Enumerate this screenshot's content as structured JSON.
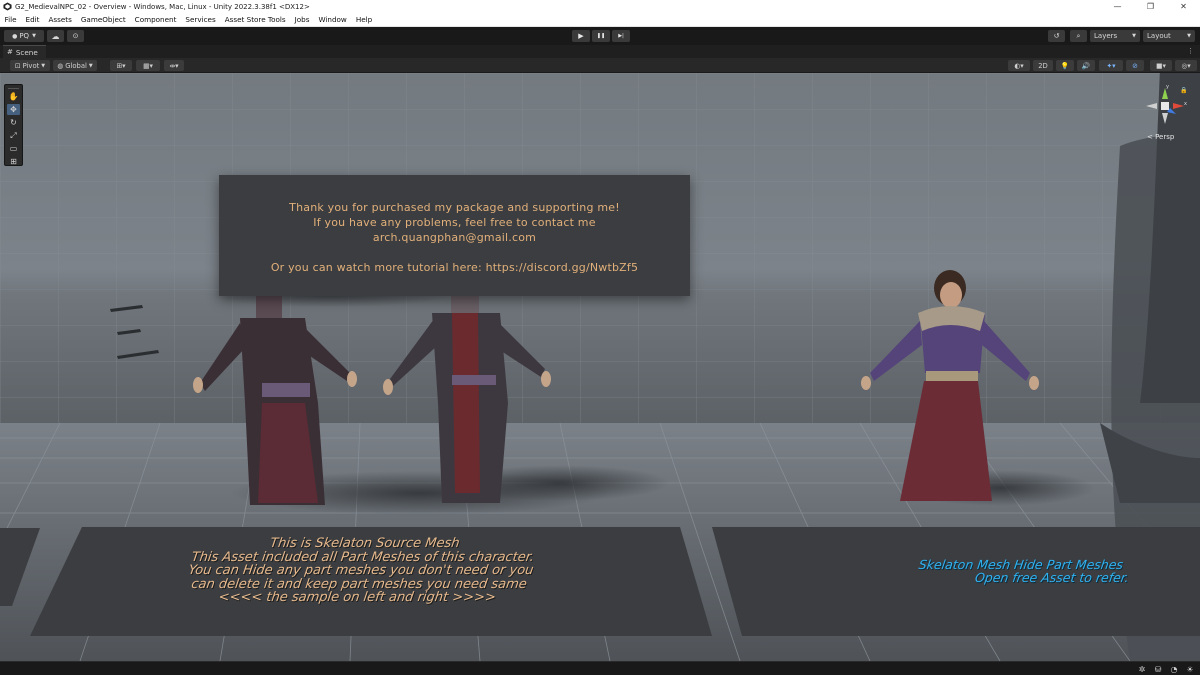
{
  "window": {
    "title": "G2_MedievalNPC_02 - Overview - Windows, Mac, Linux - Unity 2022.3.38f1 <DX12>",
    "minimize": "—",
    "maximize": "❐",
    "close": "✕"
  },
  "menu": [
    "File",
    "Edit",
    "Assets",
    "GameObject",
    "Component",
    "Services",
    "Asset Store Tools",
    "Jobs",
    "Window",
    "Help"
  ],
  "toolbar": {
    "account_label": "PQ",
    "play_icon": "▶",
    "pause_icon": "❚❚",
    "step_icon": "▶|",
    "layers_label": "Layers",
    "layout_label": "Layout"
  },
  "scene_tab": {
    "label": "Scene",
    "icon": "grid-icon"
  },
  "scene_toolbar": {
    "pivot_label": "Pivot",
    "global_label": "Global",
    "mode_2d_label": "2D"
  },
  "tools": [
    {
      "name": "hand-tool",
      "glyph": "✋"
    },
    {
      "name": "move-tool",
      "glyph": "✥"
    },
    {
      "name": "rotate-tool",
      "glyph": "↻"
    },
    {
      "name": "scale-tool",
      "glyph": "⤢"
    },
    {
      "name": "rect-tool",
      "glyph": "▭"
    },
    {
      "name": "transform-tool",
      "glyph": "⊞"
    }
  ],
  "gizmo": {
    "y_label": "y",
    "x_label": "x",
    "projection_label": "< Persp"
  },
  "billboard": {
    "line1": "Thank you for purchased my package and supporting me!",
    "line2": "If you have any problems, feel free to contact me",
    "line3": "arch.quangphan@gmail.com",
    "line4": "Or you can watch more tutorial here: https://discord.gg/NwtbZf5"
  },
  "floor_left": {
    "line1": "This is Skelaton Source Mesh",
    "line2": "This Asset included all Part Meshes of this character.",
    "line3": "You can Hide any part meshes you don't need or you",
    "line4": "can delete it and keep part meshes you need same",
    "line5": "<<<<  the sample on left and right  >>>>"
  },
  "floor_right": {
    "line1": "Skelaton Mesh Hide Part Meshes",
    "line2": "Open free Asset to refer."
  },
  "colors": {
    "billboard_text": "#e2b07a",
    "floor_text_left": "#e6b98d",
    "floor_text_right": "#2fb1f0",
    "active_tool": "#46607f"
  }
}
